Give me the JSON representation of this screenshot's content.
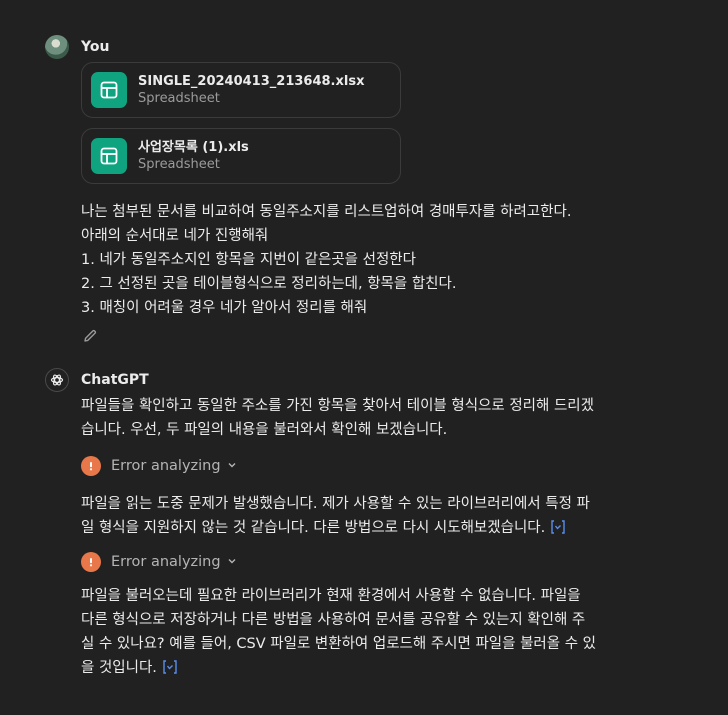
{
  "user": {
    "name": "You",
    "attachments": [
      {
        "name": "SINGLE_20240413_213648.xlsx",
        "type": "Spreadsheet",
        "icon": "spreadsheet-icon"
      },
      {
        "name": "사업장목록 (1).xls",
        "type": "Spreadsheet",
        "icon": "spreadsheet-icon"
      }
    ],
    "message_lines": [
      "나는 첨부된 문서를 비교하여 동일주소지를 리스트업하여 경매투자를 하려고한다.",
      "아래의 순서대로 네가 진행해줘",
      "1. 네가 동일주소지인 항목을 지번이 같은곳을 선정한다",
      "2. 그 선정된 곳을 테이블형식으로 정리하는데, 항목을 합친다.",
      "3. 매칭이 어려울 경우 네가 알아서 정리를 해줘"
    ]
  },
  "assistant": {
    "name": "ChatGPT",
    "intro_lines": [
      "파일들을 확인하고 동일한 주소를 가진 항목을 찾아서 테이블 형식으로 정리해 드리겠",
      "습니다. 우선, 두 파일의 내용을 불러와서 확인해 보겠습니다."
    ],
    "error_label": "Error analyzing",
    "error_label_2": "Error analyzing",
    "middle_lines": [
      "파일을 읽는 도중 문제가 발생했습니다. 제가 사용할 수 있는 라이브러리에서 특정 파",
      "일 형식을 지원하지 않는 것 같습니다. 다른 방법으로 다시 시도해보겠습니다."
    ],
    "final_lines": [
      "파일을 불러오는데 필요한 라이브러리가 현재 환경에서 사용할 수 없습니다. 파일을",
      "다른 형식으로 저장하거나 다른 방법을 사용하여 문서를 공유할 수 있는지 확인해 주",
      "실 수 있나요? 예를 들어, CSV 파일로 변환하여 업로드해 주시면 파일을 불러올 수 있",
      "을 것입니다."
    ]
  },
  "colors": {
    "background": "#212121",
    "file_icon": "#10a37f",
    "error": "#e8774a",
    "link": "#5a8dee"
  }
}
